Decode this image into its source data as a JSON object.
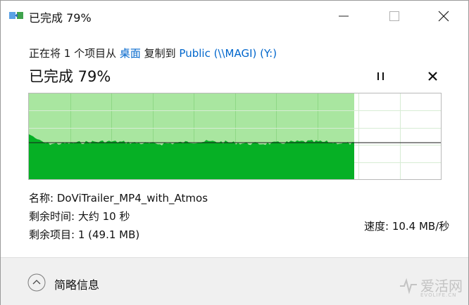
{
  "window": {
    "title": "已完成 79%",
    "icon": "copy-files-icon"
  },
  "copy": {
    "prefix": "正在将 1 个项目从 ",
    "source": "桌面",
    "middle": " 复制到 ",
    "destination": "Public (\\\\MAGI) (Y:)"
  },
  "status": {
    "label": "已完成 79%",
    "percent_complete": 79
  },
  "graph": {
    "speed_label": "速度: 10.4 MB/秒",
    "progress_fraction": 0.79,
    "fill_color": "#06b025",
    "completed_bg": "#a9e6a0"
  },
  "details": {
    "name_label": "名称: ",
    "name_value": "DoViTrailer_MP4_with_Atmos",
    "time_label": "剩余时间: ",
    "time_value": "大约 10 秒",
    "items_label": "剩余项目: ",
    "items_value": "1 (49.1 MB)"
  },
  "footer": {
    "toggle_label": "简略信息"
  },
  "watermark": {
    "text": "爱活网",
    "sub": "EVOLIFE.CN"
  }
}
